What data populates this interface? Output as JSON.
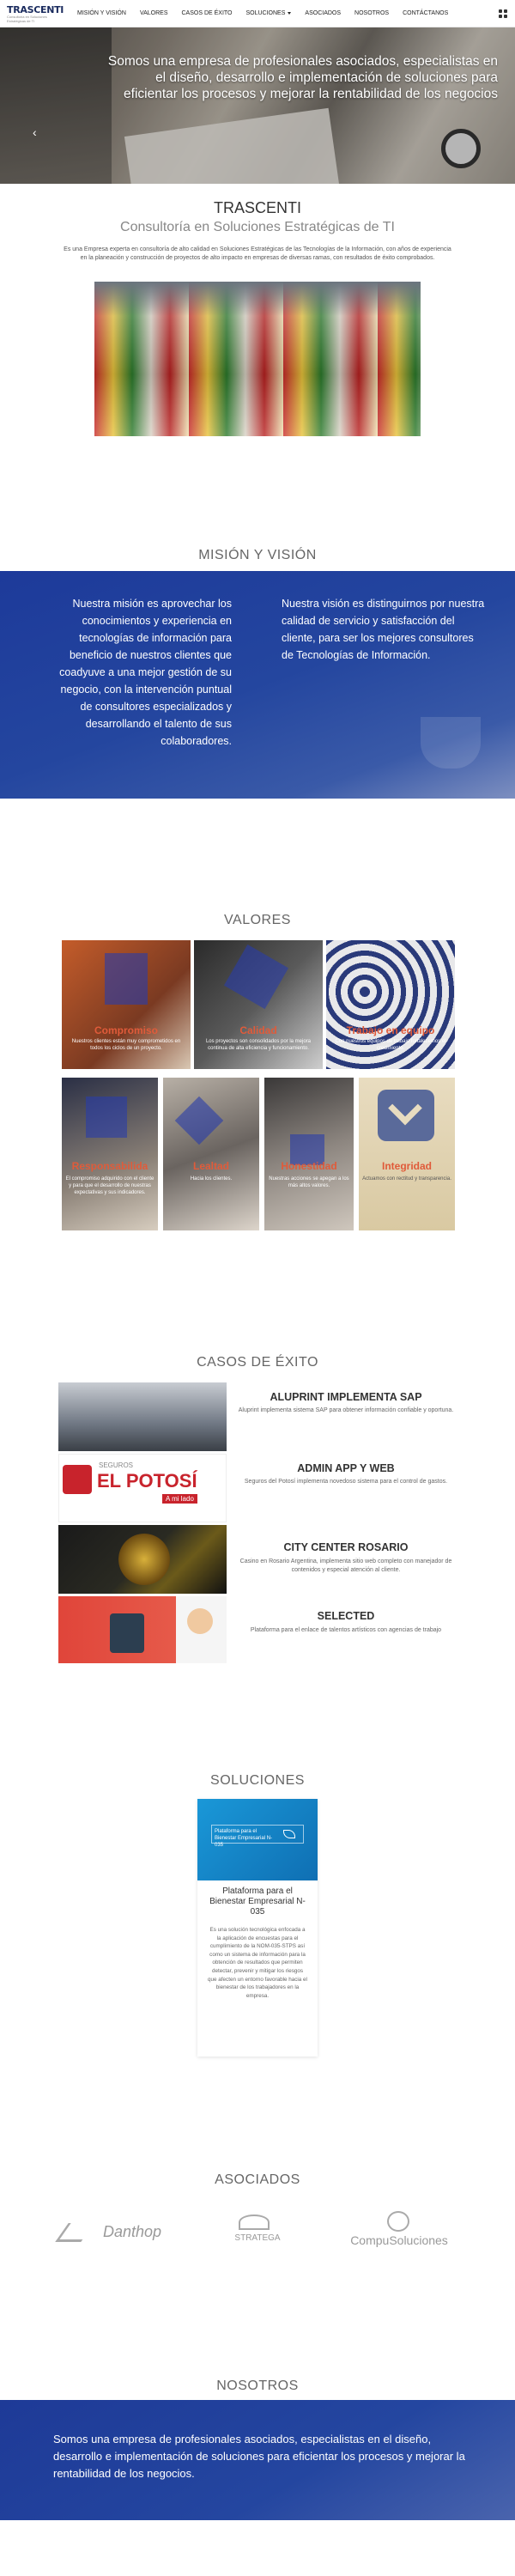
{
  "nav": {
    "logo_main": "TRASCENTI",
    "logo_tagline": "Consultoría en Soluciones Estratégicas de TI",
    "items": [
      {
        "label": "MISIÓN Y VISIÓN"
      },
      {
        "label": "VALORES"
      },
      {
        "label": "CASOS DE ÉXITO"
      },
      {
        "label": "SOLUCIONES"
      },
      {
        "label": "ASOCIADOS"
      },
      {
        "label": "NOSOTROS"
      },
      {
        "label": "CONTÁCTANOS"
      }
    ],
    "apps_icon": "grid-icon"
  },
  "hero": {
    "text": "Somos una empresa de profesionales asociados, especialistas en el diseño, desarrollo e implementación de soluciones para eficientar los procesos y mejorar la rentabilidad de los negocios",
    "prev_icon": "chevron-left-icon",
    "prev_glyph": "‹"
  },
  "intro": {
    "title": "TRASCENTI",
    "subtitle": "Consultoría en Soluciones Estratégicas de TI",
    "text": "Es una Empresa experta en consultoría de alto calidad en Soluciones Estratégicas de las Tecnologías de la Información, con años de experiencia en la planeación y construcción de proyectos de alto impacto en empresas de diversas ramas, con resultados de éxito comprobados."
  },
  "mision": {
    "title": "MISIÓN Y VISIÓN",
    "mision_text": "Nuestra misión es aprovechar los conocimientos y experiencia en tecnologías de información para beneficio de nuestros clientes que coadyuve a una mejor gestión de su negocio, con la intervención puntual de consultores especializados y desarrollando el talento de sus colaboradores.",
    "vision_text": "Nuestra visión es distinguirnos por nuestra calidad de servicio y satisfacción del cliente, para ser los mejores consultores de Tecnologías de Información."
  },
  "valores": {
    "title": "VALORES",
    "items": [
      {
        "title": "Compromiso",
        "desc": "Nuestros clientes están muy comprometidos en todos los ciclos de un proyecto."
      },
      {
        "title": "Calidad",
        "desc": "Los proyectos son consolidados por la mejora continua de alta eficiencia y funcionamiento."
      },
      {
        "title": "Trabajo en equipo",
        "desc": "Con nuestros equipos de trabajo fortalecemos el crecimiento."
      },
      {
        "title": "Responsabilida",
        "desc": "El compromiso adquirido con el cliente y para que el desarrollo de nuestras expectativas y sus indicadores."
      },
      {
        "title": "Lealtad",
        "desc": "Hacia los clientes."
      },
      {
        "title": "Honestidad",
        "desc": "Nuestras acciones se apegan a los más altos valores."
      },
      {
        "title": "Integridad",
        "desc": "Actuamos con rectitud y transparencia."
      }
    ]
  },
  "casos": {
    "title": "CASOS DE ÉXITO",
    "items": [
      {
        "title": "ALUPRINT IMPLEMENTA SAP",
        "desc": "Aluprint implementa sistema SAP para obtener información confiable y oportuna."
      },
      {
        "title": "ADMIN APP Y WEB",
        "desc": "Seguros del Potosí implementa novedoso sistema para el control de gastos."
      },
      {
        "title": "CITY CENTER ROSARIO",
        "desc": "Casino en Rosario Argentina, implementa sitio web completo con manejador de contenidos y especial atención al cliente."
      },
      {
        "title": "SELECTED",
        "desc": "Plataforma para el enlace de talentos artísticos con agencias de trabajo"
      }
    ],
    "potosi_small": "SEGUROS",
    "potosi_big": "EL POTOSÍ",
    "potosi_tag": "A mi lado"
  },
  "soluciones": {
    "title": "SOLUCIONES",
    "card_image_label": "Plataforma para el Bienestar Empresarial N-035",
    "card_title": "Plataforma para el Bienestar Empresarial N-035",
    "card_desc": "Es una solución tecnológica enfocada a la aplicación de encuestas para el cumplimiento de la NOM-035-STPS así como un sistema de información para la obtención de resultados que permiten detectar, prevenir y mitigar los riesgos que afecten un entorno favorable hacia el bienestar de los trabajadores en la empresa."
  },
  "asociados": {
    "title": "ASOCIADOS",
    "logos": [
      {
        "label": "Danthop"
      },
      {
        "label": "STRATEGA"
      },
      {
        "label": "CompuSoluciones"
      }
    ]
  },
  "nosotros": {
    "title": "NOSOTROS",
    "text": "Somos una empresa de profesionales asociados, especialistas en el diseño, desarrollo e implementación de soluciones para eficientar los procesos y mejorar la rentabilidad de los negocios."
  },
  "colors": {
    "brand_blue": "#1d3a9a",
    "accent_orange": "#e05b3a",
    "solution_blue": "#1a98d8"
  }
}
